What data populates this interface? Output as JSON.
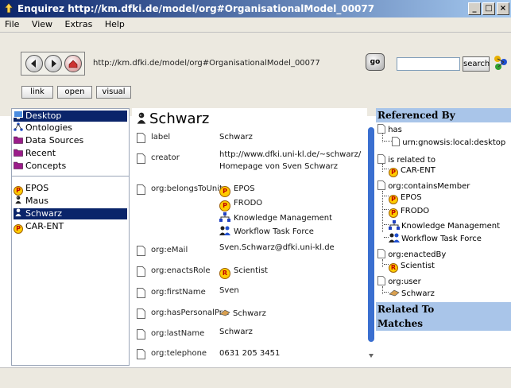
{
  "window": {
    "title": "Enquirez http://km.dfki.de/model/org#OrganisationalModel_00077",
    "min": "_",
    "max": "□",
    "close": "×"
  },
  "menu": [
    "File",
    "View",
    "Extras",
    "Help"
  ],
  "toolbar": {
    "url": "http://km.dfki.de/model/org#OrganisationalModel_00077",
    "go_label": "go",
    "search_label": "search",
    "view_buttons": [
      "link",
      "open",
      "visual"
    ]
  },
  "sidebar": {
    "top_items": [
      {
        "label": "Desktop",
        "icon": "desktop-icon"
      },
      {
        "label": "Ontologies",
        "icon": "ontology-icon"
      },
      {
        "label": "Data Sources",
        "icon": "folder-icon"
      },
      {
        "label": "Recent",
        "icon": "folder-icon"
      },
      {
        "label": "Concepts",
        "icon": "folder-icon"
      }
    ],
    "bottom_items": [
      {
        "label": "EPOS",
        "icon": "project-icon"
      },
      {
        "label": "Maus",
        "icon": "person-icon"
      },
      {
        "label": "Schwarz",
        "icon": "person-icon"
      },
      {
        "label": "CAR-ENT",
        "icon": "project-icon"
      }
    ]
  },
  "resource": {
    "title": "Schwarz",
    "properties": [
      {
        "key": "label",
        "values": [
          "Schwarz"
        ]
      },
      {
        "key": "creator",
        "values": [
          "http://www.dfki.uni-kl.de/~schwarz/",
          "Homepage von Sven Schwarz"
        ]
      },
      {
        "key": "org:belongsToUnit",
        "values": [
          "EPOS",
          "FRODO",
          "Knowledge Management",
          "Workflow Task Force"
        ]
      },
      {
        "key": "org:eMail",
        "values": [
          "Sven.Schwarz@dfki.uni-kl.de"
        ]
      },
      {
        "key": "org:enactsRole",
        "values": [
          "Scientist"
        ]
      },
      {
        "key": "org:firstName",
        "values": [
          "Sven"
        ]
      },
      {
        "key": "org:hasPersonalPr...",
        "values": [
          "Schwarz"
        ]
      },
      {
        "key": "org:lastName",
        "values": [
          "Schwarz"
        ]
      },
      {
        "key": "org:telephone",
        "values": [
          "0631 205 3451"
        ]
      }
    ]
  },
  "referenced_by": {
    "title": "Referenced By",
    "items": [
      {
        "label": "has"
      },
      {
        "label": "urn:gnowsis:local:desktop"
      },
      {
        "label": "is related to"
      },
      {
        "label": "CAR-ENT"
      },
      {
        "label": "org:containsMember"
      },
      {
        "label": "EPOS"
      },
      {
        "label": "FRODO"
      },
      {
        "label": "Knowledge Management"
      },
      {
        "label": "Workflow Task Force"
      },
      {
        "label": "org:enactedBy"
      },
      {
        "label": "Scientist"
      },
      {
        "label": "org:user"
      },
      {
        "label": "Schwarz"
      }
    ]
  },
  "related_to": {
    "title": "Related To"
  },
  "matches": {
    "title": "Matches"
  },
  "badges": {
    "project": "P",
    "role": "R"
  }
}
